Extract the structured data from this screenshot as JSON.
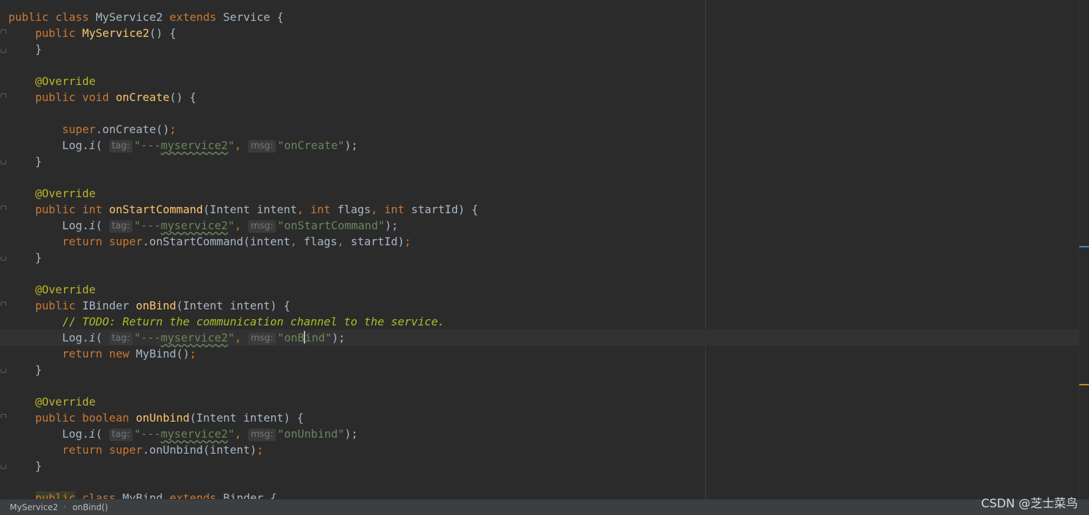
{
  "editor": {
    "lines": {
      "l1": {
        "kw_public": "public",
        "kw_class": "class",
        "name": "MyService2",
        "kw_extends": "extends",
        "parent": "Service",
        "brace": " {"
      },
      "l2": {
        "kw_public": "public",
        "name": "MyService2",
        "rest": "() {"
      },
      "l3": {
        "text": "}"
      },
      "l5": {
        "annotation": "@Override"
      },
      "l6": {
        "kw_public": "public",
        "kw_void": "void",
        "name": "onCreate",
        "rest": "() {"
      },
      "l8": {
        "kw_super": "super",
        "call": ".onCreate()",
        "semi": ";"
      },
      "l9": {
        "log": "Log.",
        "method": "i",
        "open": "(",
        "tag_hint": "tag:",
        "tag_q1": "\"---",
        "tag_word": "myservice2",
        "tag_q2": "\"",
        "comma": ",",
        "msg_hint": "msg:",
        "msg": "\"onCreate\"",
        "close": ");"
      },
      "l10": {
        "text": "}"
      },
      "l12": {
        "annotation": "@Override"
      },
      "l13": {
        "kw_public": "public",
        "kw_int": "int",
        "name": "onStartCommand",
        "p1": "(Intent intent",
        "c1": ",",
        "kw_int2": "int",
        "p2": "flags",
        "c2": ",",
        "kw_int3": "int",
        "p3": "startId) {"
      },
      "l14": {
        "log": "Log.",
        "method": "i",
        "open": "(",
        "tag_hint": "tag:",
        "tag_q1": "\"---",
        "tag_word": "myservice2",
        "tag_q2": "\"",
        "comma": ",",
        "msg_hint": "msg:",
        "msg": "\"onStartCommand\"",
        "close": ");"
      },
      "l15": {
        "kw_return": "return",
        "kw_super": "super",
        "call": ".onStartCommand(intent",
        "c1": ",",
        "a2": "flags",
        "c2": ",",
        "a3": "startId)",
        "semi": ";"
      },
      "l16": {
        "text": "}"
      },
      "l18": {
        "annotation": "@Override"
      },
      "l19": {
        "kw_public": "public",
        "type": "IBinder",
        "name": "onBind",
        "rest": "(Intent intent) {"
      },
      "l20": {
        "comment": "// ",
        "todo": "TODO: Return the communication channel to the service."
      },
      "l21": {
        "log": "Log.",
        "method": "i",
        "open": "(",
        "tag_hint": "tag:",
        "tag_q1": "\"---",
        "tag_word": "myservice2",
        "tag_q2": "\"",
        "comma": ",",
        "msg_hint": "msg:",
        "msg_a": "\"onB",
        "msg_b": "ind\"",
        "close": ");"
      },
      "l22": {
        "kw_return": "return",
        "kw_new": "new",
        "call": "MyBind()",
        "semi": ";"
      },
      "l23": {
        "text": "}"
      },
      "l25": {
        "annotation": "@Override"
      },
      "l26": {
        "kw_public": "public",
        "kw_boolean": "boolean",
        "name": "onUnbind",
        "rest": "(Intent intent) {"
      },
      "l27": {
        "log": "Log.",
        "method": "i",
        "open": "(",
        "tag_hint": "tag:",
        "tag_q1": "\"---",
        "tag_word": "myservice2",
        "tag_q2": "\"",
        "comma": ",",
        "msg_hint": "msg:",
        "msg": "\"onUnbind\"",
        "close": ");"
      },
      "l28": {
        "kw_return": "return",
        "kw_super": "super",
        "call": ".onUnbind(intent)",
        "semi": ";"
      },
      "l29": {
        "text": "}"
      },
      "l31": {
        "kw_public": "public",
        "kw_class": "class",
        "name": "MyBind",
        "kw_extends": "extends",
        "parent": "Binder",
        "brace": " {"
      }
    }
  },
  "status_bar": {
    "breadcrumb": [
      "MyService2",
      "onBind()"
    ],
    "separator": "›"
  },
  "watermark": "CSDN @芝士菜鸟",
  "colors": {
    "background": "#2b2b2b",
    "keyword": "#cc7832",
    "function": "#ffc66d",
    "annotation": "#bbb529",
    "string": "#6a8759",
    "text": "#a9b7c6",
    "todo": "#a8c023"
  }
}
